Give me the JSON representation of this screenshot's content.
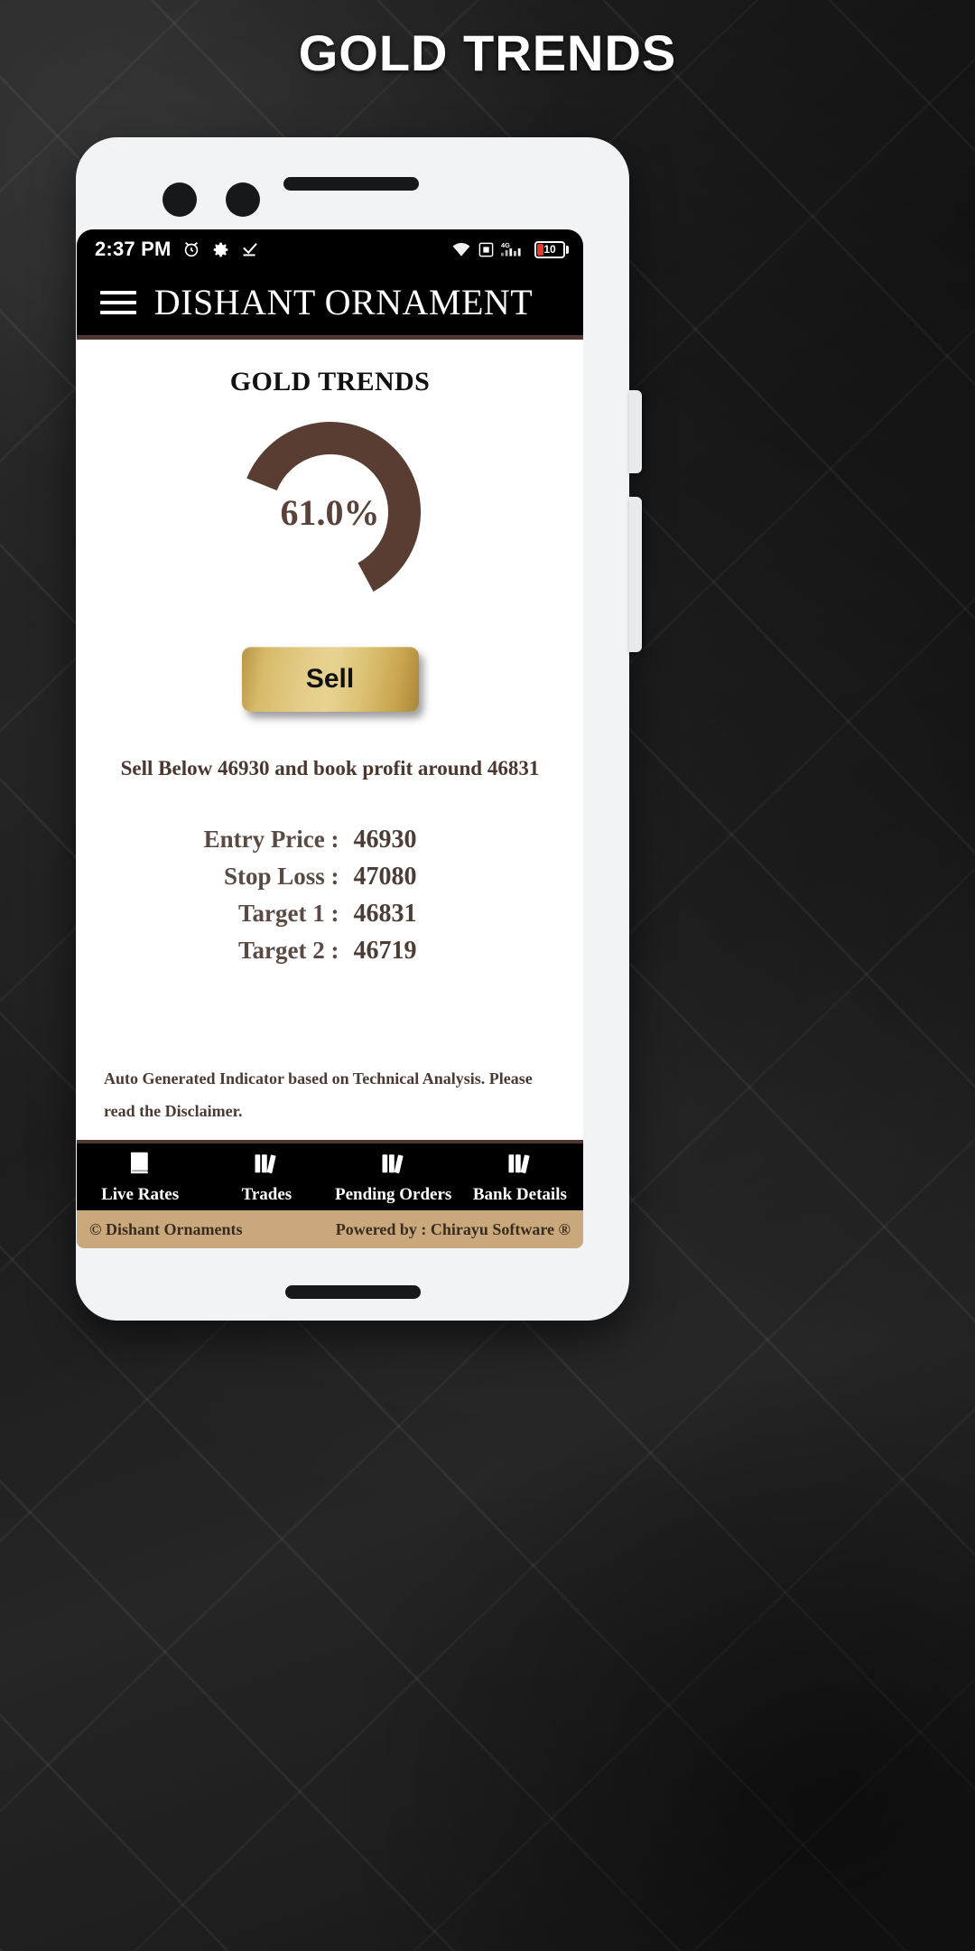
{
  "page": {
    "heading": "GOLD TRENDS"
  },
  "status_bar": {
    "time": "2:37 PM",
    "left_icons": [
      "alarm-icon",
      "gear-icon",
      "check-icon"
    ],
    "right_icons": [
      "wifi-icon",
      "screenshot-icon",
      "signal-4g-icon"
    ],
    "network_label": "4G",
    "battery_level": "10"
  },
  "app_bar": {
    "menu_icon": "hamburger-icon",
    "title": "DISHANT ORNAMENT"
  },
  "main": {
    "section_title": "GOLD TRENDS",
    "gauge": {
      "value_label": "61.0%",
      "percent": 61.0,
      "arc_color": "#5a3d32",
      "track_color": "#ffffff"
    },
    "action_button": {
      "label": "Sell"
    },
    "advice": "Sell Below 46930 and book profit around 46831",
    "details": [
      {
        "label": "Entry Price :",
        "value": "46930"
      },
      {
        "label": "Stop Loss :",
        "value": "47080"
      },
      {
        "label": "Target 1 :",
        "value": "46831"
      },
      {
        "label": "Target 2 :",
        "value": "46719"
      }
    ],
    "disclaimer_line1": "Auto Generated Indicator based on Technical Analysis. Please",
    "disclaimer_line2": "read the Disclaimer."
  },
  "bottom_nav": [
    {
      "label": "Live Rates",
      "icon": "book-icon"
    },
    {
      "label": "Trades",
      "icon": "books-icon"
    },
    {
      "label": "Pending Orders",
      "icon": "books-icon"
    },
    {
      "label": "Bank Details",
      "icon": "books-icon"
    }
  ],
  "footer": {
    "left": "© Dishant Ornaments",
    "right": "Powered by : Chirayu Software ®"
  },
  "colors": {
    "accent_brown": "#4e3830",
    "gold": "#e3cb86",
    "footer_bg": "#c9a97b"
  }
}
